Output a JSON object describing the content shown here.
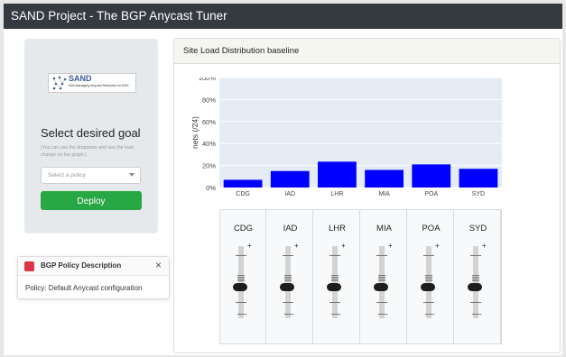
{
  "app": {
    "title": "SAND Project - The BGP Anycast Tuner"
  },
  "logo": {
    "title": "SAND",
    "subtitle": "Self-Managing Anycast Networks for DNS"
  },
  "goal": {
    "title": "Select desired goal",
    "help": "(You can use the dropdown and see the load change on the graph.)",
    "dropdown_placeholder": "Select a policy",
    "deploy_label": "Deploy"
  },
  "policy_toast": {
    "title": "BGP Policy Description",
    "close": "×",
    "body": "Policy: Default Anycast configuration",
    "color": "#dc3545"
  },
  "panel": {
    "title": "Site Load Distribution baseline"
  },
  "chart_data": {
    "type": "bar",
    "categories": [
      "CDG",
      "IAD",
      "LHR",
      "MIA",
      "POA",
      "SYD"
    ],
    "values": [
      7,
      15,
      23.5,
      16,
      21,
      17
    ],
    "ylabel": "nets (/24)",
    "ylim": [
      0,
      100
    ],
    "yticks": [
      "0%",
      "20%",
      "40%",
      "60%",
      "80%",
      "100%"
    ],
    "bar_color": "#0000ff",
    "plot_bg": "#e5ecf6",
    "grid": true
  },
  "sliders": [
    {
      "label": "CDG",
      "plus": "+",
      "minus": "-"
    },
    {
      "label": "IAD",
      "plus": "+",
      "minus": "-"
    },
    {
      "label": "LHR",
      "plus": "+",
      "minus": "-"
    },
    {
      "label": "MIA",
      "plus": "+",
      "minus": "-"
    },
    {
      "label": "POA",
      "plus": "+",
      "minus": "-"
    },
    {
      "label": "SYD",
      "plus": "+",
      "minus": "-"
    }
  ]
}
